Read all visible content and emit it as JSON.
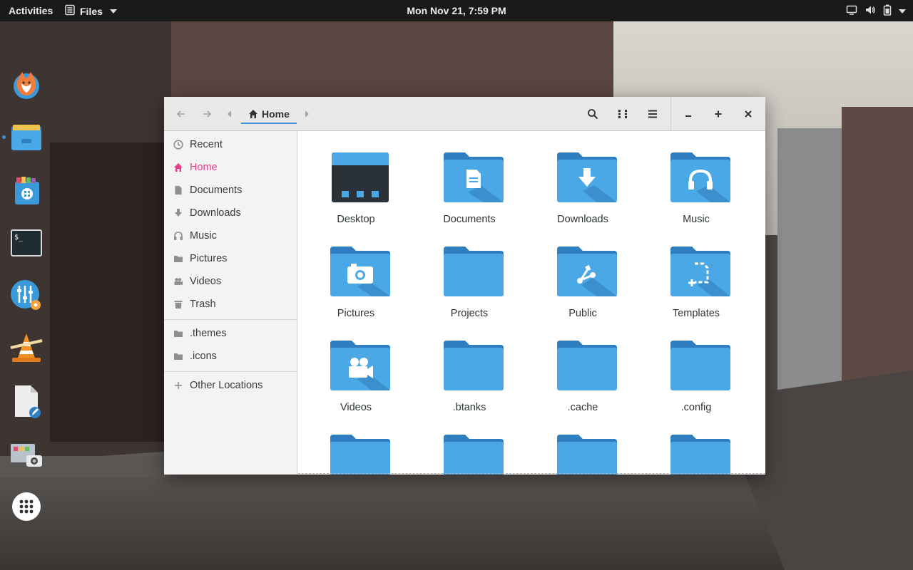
{
  "topbar": {
    "activities": "Activities",
    "app_name": "Files",
    "clock": "Mon Nov 21,  7:59 PM",
    "tray_icons": [
      "screen-icon",
      "volume-icon",
      "battery-icon",
      "power-menu-caret"
    ]
  },
  "dock": {
    "items": [
      {
        "name": "firefox-icon"
      },
      {
        "name": "files-icon",
        "running": true
      },
      {
        "name": "software-center-icon"
      },
      {
        "name": "terminal-icon"
      },
      {
        "name": "mixer-settings-icon"
      },
      {
        "name": "vlc-icon"
      },
      {
        "name": "text-editor-icon"
      },
      {
        "name": "screenshot-tool-icon"
      },
      {
        "name": "show-applications-icon"
      }
    ]
  },
  "window": {
    "path": {
      "current": "Home"
    },
    "sidebar": {
      "items": [
        {
          "label": "Recent",
          "icon": "clock-icon"
        },
        {
          "label": "Home",
          "icon": "home-icon",
          "active": true
        },
        {
          "label": "Documents",
          "icon": "document-icon"
        },
        {
          "label": "Downloads",
          "icon": "download-icon"
        },
        {
          "label": "Music",
          "icon": "headphones-icon"
        },
        {
          "label": "Pictures",
          "icon": "pictures-icon"
        },
        {
          "label": "Videos",
          "icon": "videos-icon"
        },
        {
          "label": "Trash",
          "icon": "trash-icon"
        }
      ],
      "bookmarks": [
        {
          "label": ".themes",
          "icon": "folder-icon"
        },
        {
          "label": ".icons",
          "icon": "folder-icon"
        }
      ],
      "other_locations": {
        "label": "Other Locations",
        "icon": "plus-icon"
      }
    },
    "files": [
      {
        "label": "Desktop",
        "emblem": "desktop"
      },
      {
        "label": "Documents",
        "emblem": "document"
      },
      {
        "label": "Downloads",
        "emblem": "download"
      },
      {
        "label": "Music",
        "emblem": "music"
      },
      {
        "label": "Pictures",
        "emblem": "camera"
      },
      {
        "label": "Projects",
        "emblem": "none"
      },
      {
        "label": "Public",
        "emblem": "share"
      },
      {
        "label": "Templates",
        "emblem": "template"
      },
      {
        "label": "Videos",
        "emblem": "video"
      },
      {
        "label": ".btanks",
        "emblem": "none"
      },
      {
        "label": ".cache",
        "emblem": "none"
      },
      {
        "label": ".config",
        "emblem": "none"
      },
      {
        "label": "",
        "emblem": "none"
      },
      {
        "label": "",
        "emblem": "none"
      },
      {
        "label": "",
        "emblem": "none"
      },
      {
        "label": "",
        "emblem": "none"
      }
    ]
  },
  "colors": {
    "folder_front": "#4aa8e6",
    "folder_back": "#2f7fc0",
    "folder_shadow": "#3a8fcc",
    "accent_pink": "#e33d8d",
    "accent_blue": "#3d8fd9",
    "topbar_bg": "#1a1a1a"
  }
}
